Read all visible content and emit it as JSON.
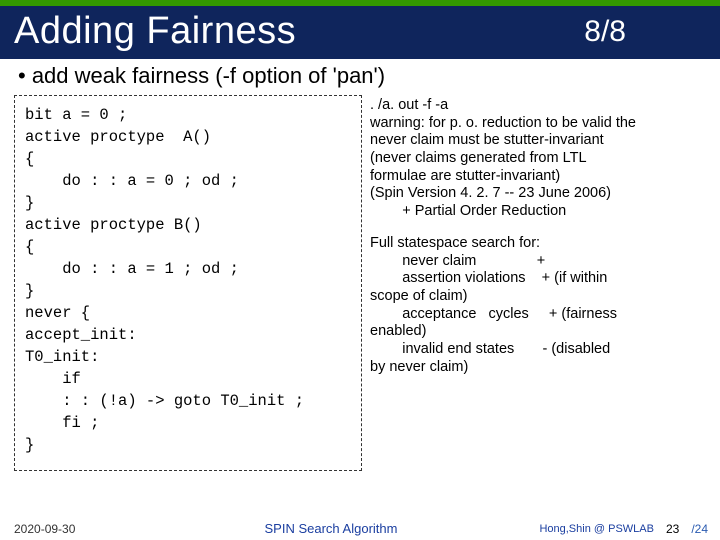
{
  "header": {
    "title": "Adding Fairness",
    "page_indicator": "8/8"
  },
  "bullet": "• add weak fairness (-f option of 'pan')",
  "code": "bit a = 0 ;\nactive proctype  A()\n{\n    do : : a = 0 ; od ;\n}\nactive proctype B()\n{\n    do : : a = 1 ; od ;\n}\nnever {\naccept_init:\nT0_init:\n    if\n    : : (!a) -> goto T0_init ;\n    fi ;\n}",
  "output": {
    "p1": ". /a. out -f -a\nwarning: for p. o. reduction to be valid the\nnever claim must be stutter-invariant\n(never claims generated from LTL\nformulae are stutter-invariant)\n(Spin Version 4. 2. 7 -- 23 June 2006)\n        + Partial Order Reduction",
    "p2": "Full statespace search for:\n        never claim               +\n        assertion violations    + (if within\nscope of claim)\n        acceptance   cycles     + (fairness\nenabled)\n        invalid end states       - (disabled\nby never claim)"
  },
  "footer": {
    "date": "2020-09-30",
    "mid": "SPIN Search Algorithm",
    "lab": "Hong,Shin @ PSWLAB",
    "page": "23",
    "total": "/24"
  }
}
